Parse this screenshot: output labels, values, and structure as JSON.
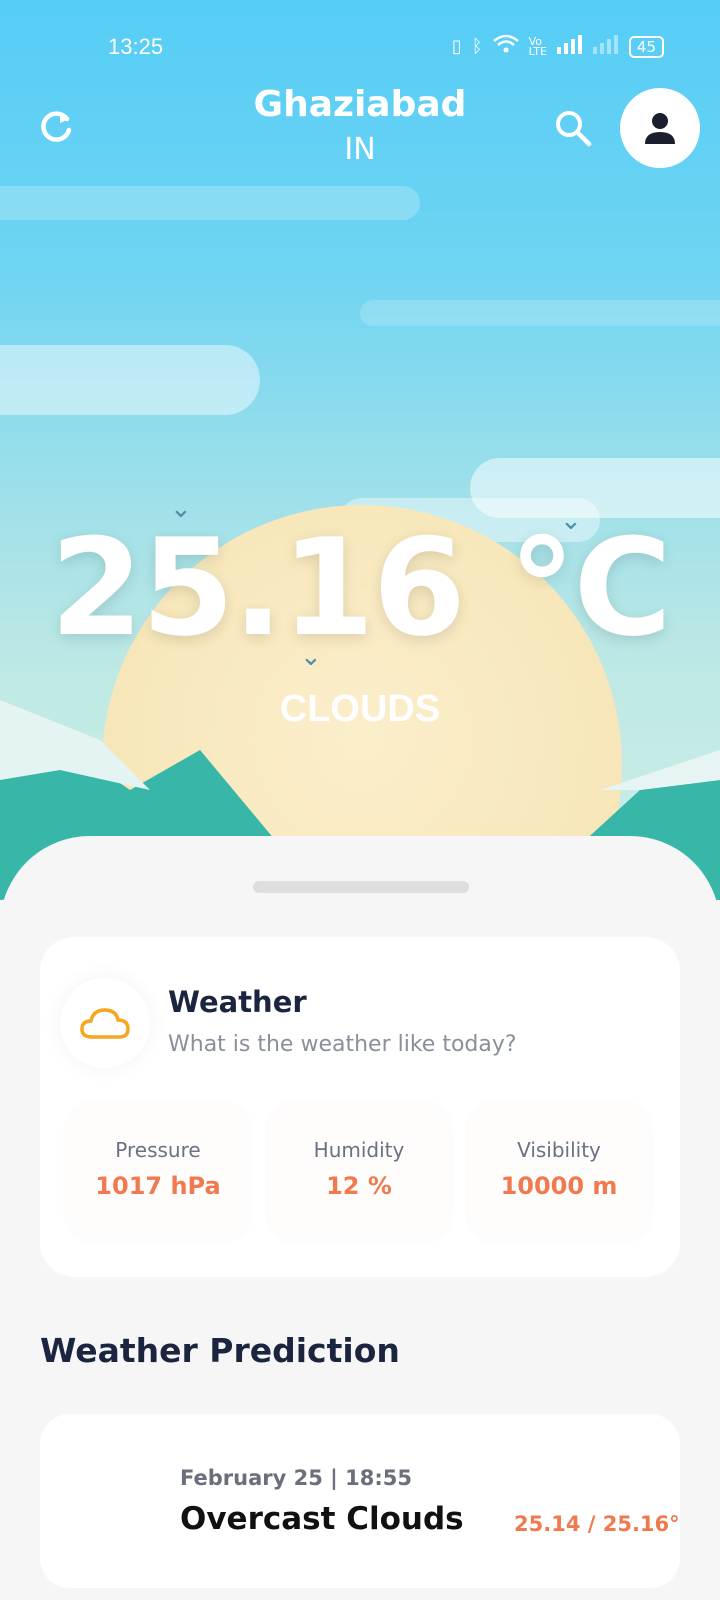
{
  "status_bar": {
    "time": "13:25",
    "icons": [
      "vibrate-icon",
      "bluetooth-icon",
      "wifi-icon",
      "volte-icon",
      "signal-icon",
      "signal-empty-icon"
    ],
    "battery": "45"
  },
  "header": {
    "city": "Ghaziabad",
    "country": "IN"
  },
  "current": {
    "temperature": "25.16 °C",
    "condition": "CLOUDS"
  },
  "weather_card": {
    "title": "Weather",
    "subtitle": "What is the weather like today?",
    "metrics": [
      {
        "label": "Pressure",
        "value": "1017 hPa"
      },
      {
        "label": "Humidity",
        "value": "12 %"
      },
      {
        "label": "Visibility",
        "value": "10000 m"
      }
    ]
  },
  "prediction": {
    "section_title": "Weather Prediction",
    "items": [
      {
        "date": "February 25 | 18:55",
        "description": "Overcast Clouds",
        "range": "25.14 / 25.16°"
      }
    ]
  },
  "colors": {
    "accent": "#f07a4f",
    "sky_top": "#55cdf6",
    "heading": "#1b2540",
    "cloud_icon": "#f5a623"
  }
}
